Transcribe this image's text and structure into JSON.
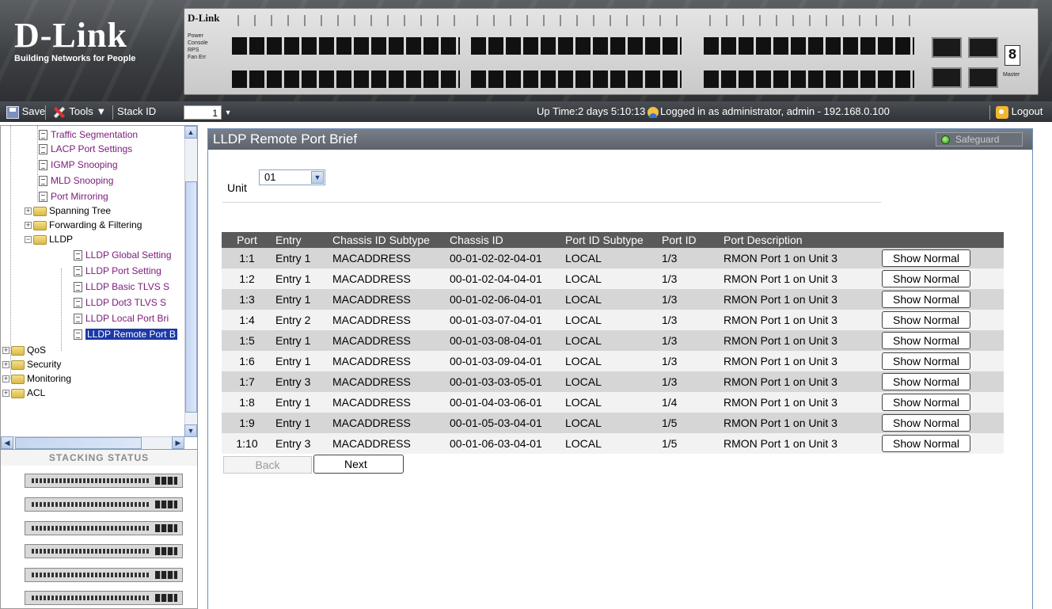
{
  "header": {
    "logo_brand": "D-Link",
    "logo_tagline": "Building Networks for People",
    "panel_brand": "D-Link",
    "panel_leds": [
      "Power",
      "Console",
      "RPS",
      "Fan Err"
    ],
    "seven_seg": "8",
    "master_label": "Master"
  },
  "toolbar": {
    "save_label": "Save",
    "tools_label": "Tools",
    "stack_id_label": "Stack ID",
    "stack_id_value": "1",
    "uptime": "Up Time:2 days 5:10:13",
    "logged_in": "Logged in as administrator, admin - 192.168.0.100",
    "logout_label": "Logout"
  },
  "tree": {
    "items": [
      {
        "label": "Traffic Segmentation",
        "type": "leaf"
      },
      {
        "label": "LACP Port Settings",
        "type": "leaf"
      },
      {
        "label": "IGMP Snooping",
        "type": "leaf"
      },
      {
        "label": "MLD Snooping",
        "type": "leaf"
      },
      {
        "label": "Port Mirroring",
        "type": "leaf"
      },
      {
        "label": "Spanning Tree",
        "type": "folder"
      },
      {
        "label": "Forwarding & Filtering",
        "type": "folder"
      },
      {
        "label": "LLDP",
        "type": "folder-open"
      },
      {
        "label": "LLDP Global Setting",
        "type": "leaf"
      },
      {
        "label": "LLDP Port Setting",
        "type": "leaf"
      },
      {
        "label": "LLDP Basic TLVS S",
        "type": "leaf"
      },
      {
        "label": "LLDP Dot3 TLVS S",
        "type": "leaf"
      },
      {
        "label": "LLDP Local Port Bri",
        "type": "leaf"
      },
      {
        "label": "LLDP Remote Port B",
        "type": "leaf-selected"
      },
      {
        "label": "QoS",
        "type": "folder"
      },
      {
        "label": "Security",
        "type": "folder"
      },
      {
        "label": "Monitoring",
        "type": "folder"
      },
      {
        "label": "ACL",
        "type": "folder"
      }
    ]
  },
  "stacking": {
    "title": "STACKING STATUS",
    "unit_count": 6
  },
  "main": {
    "title": "LLDP Remote Port Brief",
    "safeguard_label": "Safeguard",
    "unit_label": "Unit",
    "unit_value": "01",
    "columns": [
      "Port",
      "Entry",
      "Chassis ID Subtype",
      "Chassis ID",
      "Port ID Subtype",
      "Port ID",
      "Port Description",
      ""
    ],
    "rows": [
      {
        "port": "1:1",
        "entry": "Entry 1",
        "chassis_subtype": "MACADDRESS",
        "chassis_id": "00-01-02-02-04-01",
        "port_subtype": "LOCAL",
        "port_id": "1/3",
        "desc": "RMON Port 1 on Unit 3",
        "action": "Show Normal"
      },
      {
        "port": "1:2",
        "entry": "Entry 1",
        "chassis_subtype": "MACADDRESS",
        "chassis_id": "00-01-02-04-04-01",
        "port_subtype": "LOCAL",
        "port_id": "1/3",
        "desc": "RMON Port 1 on Unit 3",
        "action": "Show Normal"
      },
      {
        "port": "1:3",
        "entry": "Entry 1",
        "chassis_subtype": "MACADDRESS",
        "chassis_id": "00-01-02-06-04-01",
        "port_subtype": "LOCAL",
        "port_id": "1/3",
        "desc": "RMON Port 1 on Unit 3",
        "action": "Show Normal"
      },
      {
        "port": "1:4",
        "entry": "Entry 2",
        "chassis_subtype": "MACADDRESS",
        "chassis_id": "00-01-03-07-04-01",
        "port_subtype": "LOCAL",
        "port_id": "1/3",
        "desc": "RMON Port 1 on Unit 3",
        "action": "Show Normal"
      },
      {
        "port": "1:5",
        "entry": "Entry 1",
        "chassis_subtype": "MACADDRESS",
        "chassis_id": "00-01-03-08-04-01",
        "port_subtype": "LOCAL",
        "port_id": "1/3",
        "desc": "RMON Port 1 on Unit 3",
        "action": "Show Normal"
      },
      {
        "port": "1:6",
        "entry": "Entry 1",
        "chassis_subtype": "MACADDRESS",
        "chassis_id": "00-01-03-09-04-01",
        "port_subtype": "LOCAL",
        "port_id": "1/3",
        "desc": "RMON Port 1 on Unit 3",
        "action": "Show Normal"
      },
      {
        "port": "1:7",
        "entry": "Entry 3",
        "chassis_subtype": "MACADDRESS",
        "chassis_id": "00-01-03-03-05-01",
        "port_subtype": "LOCAL",
        "port_id": "1/3",
        "desc": "RMON Port 1 on Unit 3",
        "action": "Show Normal"
      },
      {
        "port": "1:8",
        "entry": "Entry 1",
        "chassis_subtype": "MACADDRESS",
        "chassis_id": "00-01-04-03-06-01",
        "port_subtype": "LOCAL",
        "port_id": "1/4",
        "desc": "RMON Port 1 on Unit 3",
        "action": "Show Normal"
      },
      {
        "port": "1:9",
        "entry": "Entry 1",
        "chassis_subtype": "MACADDRESS",
        "chassis_id": "00-01-05-03-04-01",
        "port_subtype": "LOCAL",
        "port_id": "1/5",
        "desc": "RMON Port 1 on Unit 3",
        "action": "Show Normal"
      },
      {
        "port": "1:10",
        "entry": "Entry 3",
        "chassis_subtype": "MACADDRESS",
        "chassis_id": "00-01-06-03-04-01",
        "port_subtype": "LOCAL",
        "port_id": "1/5",
        "desc": "RMON Port 1 on Unit 3",
        "action": "Show Normal"
      }
    ],
    "back_label": "Back",
    "next_label": "Next"
  }
}
